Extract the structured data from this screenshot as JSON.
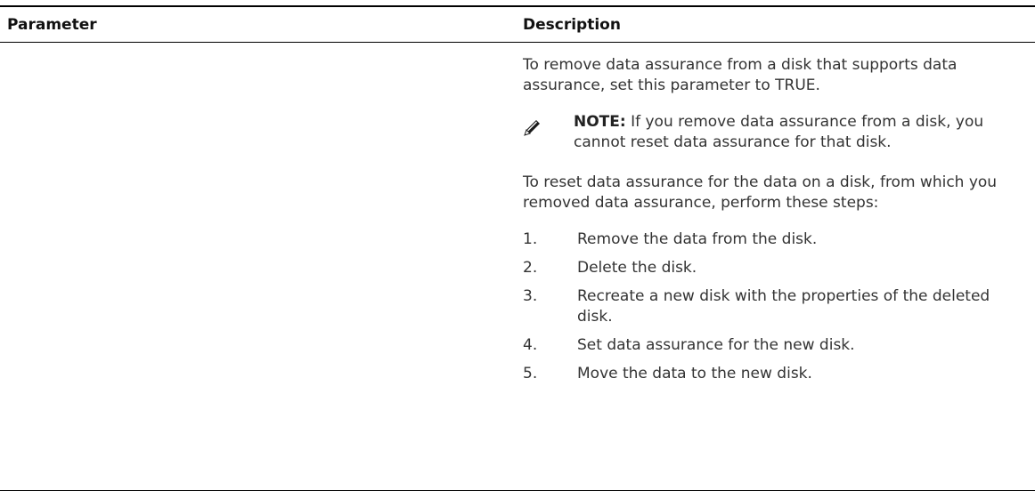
{
  "table": {
    "header": {
      "parameter": "Parameter",
      "description": "Description"
    },
    "description": {
      "intro": "To remove data assurance from a disk that supports data assurance, set this parameter to TRUE.",
      "note": {
        "icon": "pencil-note-icon",
        "label": "NOTE:",
        "text": " If you remove data assurance from a disk, you cannot reset data assurance for that disk."
      },
      "reset_intro": "To reset data assurance for the data on a disk, from which you removed data assurance, perform these steps:",
      "steps": [
        {
          "num": "1.",
          "text": "Remove the data from the disk."
        },
        {
          "num": "2.",
          "text": "Delete the disk."
        },
        {
          "num": "3.",
          "text": "Recreate a new disk with the properties of the deleted disk."
        },
        {
          "num": "4.",
          "text": "Set data assurance for the new disk."
        },
        {
          "num": "5.",
          "text": "Move the data to the new disk."
        }
      ]
    }
  }
}
